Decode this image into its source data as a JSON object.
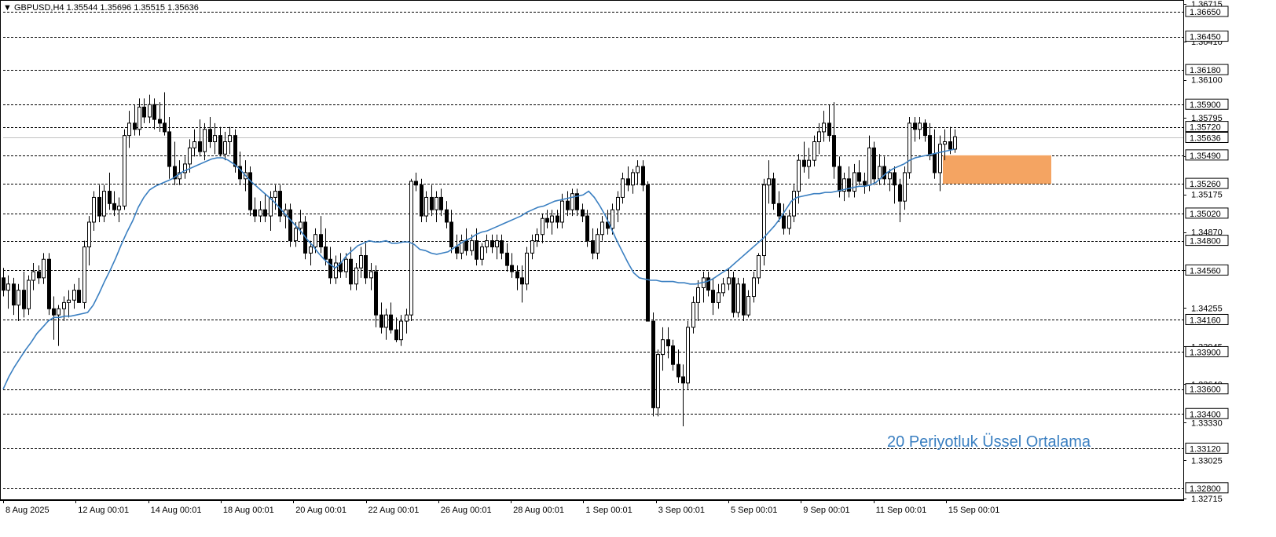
{
  "header": {
    "symbol_label": "GBPUSD,H4",
    "ohlc_label": "1.35544 1.35696 1.35515 1.35636"
  },
  "annotation": {
    "ema_label": "20 Periyotluk Üssel Ortalama"
  },
  "colors": {
    "background": "#ffffff",
    "candle": "#000000",
    "ema": "#3a7fc1",
    "zone": "#f4a462",
    "level_line": "#000000"
  },
  "chart_data": {
    "type": "candlestick",
    "symbol": "GBPUSD",
    "timeframe": "H4",
    "ylim": [
      1.3271,
      1.3672
    ],
    "y_axis_labels": [
      "1.36715",
      "1.36410",
      "1.36100",
      "1.35795",
      "1.35485",
      "1.35175",
      "1.34870",
      "1.34560",
      "1.34255",
      "1.33945",
      "1.33640",
      "1.33330",
      "1.33025",
      "1.32715"
    ],
    "price_levels": [
      "1.36650",
      "1.36450",
      "1.36180",
      "1.35900",
      "1.35720",
      "1.35490",
      "1.35260",
      "1.35020",
      "1.34800",
      "1.34560",
      "1.34160",
      "1.33900",
      "1.33600",
      "1.33400",
      "1.33120",
      "1.32800"
    ],
    "current_price": "1.35636",
    "x_labels": [
      "8 Aug 2025",
      "12 Aug 00:01",
      "14 Aug 00:01",
      "18 Aug 00:01",
      "20 Aug 00:01",
      "22 Aug 00:01",
      "26 Aug 00:01",
      "28 Aug 00:01",
      "1 Sep 00:01",
      "3 Sep 00:01",
      "5 Sep 00:01",
      "9 Sep 00:01",
      "11 Sep 00:01",
      "15 Sep 00:01"
    ],
    "candles": [
      [
        1.345,
        1.3458,
        1.3435,
        1.344
      ],
      [
        1.344,
        1.3452,
        1.3425,
        1.3445
      ],
      [
        1.3445,
        1.345,
        1.342,
        1.3428
      ],
      [
        1.3428,
        1.3445,
        1.3415,
        1.344
      ],
      [
        1.344,
        1.3455,
        1.3418,
        1.3425
      ],
      [
        1.3425,
        1.3452,
        1.342,
        1.3448
      ],
      [
        1.3448,
        1.3462,
        1.344,
        1.3455
      ],
      [
        1.3455,
        1.346,
        1.3445,
        1.345
      ],
      [
        1.345,
        1.347,
        1.3445,
        1.3465
      ],
      [
        1.3465,
        1.347,
        1.342,
        1.3425
      ],
      [
        1.3425,
        1.3435,
        1.34,
        1.342
      ],
      [
        1.342,
        1.3428,
        1.3395,
        1.3425
      ],
      [
        1.3425,
        1.3435,
        1.3415,
        1.343
      ],
      [
        1.343,
        1.344,
        1.3418,
        1.3432
      ],
      [
        1.3432,
        1.3445,
        1.3425,
        1.344
      ],
      [
        1.344,
        1.345,
        1.343,
        1.343
      ],
      [
        1.343,
        1.348,
        1.3425,
        1.3475
      ],
      [
        1.3475,
        1.35,
        1.346,
        1.3495
      ],
      [
        1.3495,
        1.352,
        1.3488,
        1.3515
      ],
      [
        1.3515,
        1.3525,
        1.3495,
        1.35
      ],
      [
        1.35,
        1.3525,
        1.3495,
        1.352
      ],
      [
        1.352,
        1.3535,
        1.3505,
        1.351
      ],
      [
        1.351,
        1.352,
        1.35,
        1.3505
      ],
      [
        1.3505,
        1.3515,
        1.3495,
        1.3508
      ],
      [
        1.3508,
        1.357,
        1.3505,
        1.3565
      ],
      [
        1.3565,
        1.3585,
        1.3555,
        1.3575
      ],
      [
        1.3575,
        1.359,
        1.3565,
        1.357
      ],
      [
        1.357,
        1.3595,
        1.3565,
        1.3588
      ],
      [
        1.3588,
        1.3595,
        1.3575,
        1.358
      ],
      [
        1.358,
        1.3598,
        1.3575,
        1.359
      ],
      [
        1.359,
        1.3595,
        1.357,
        1.3578
      ],
      [
        1.3578,
        1.3592,
        1.3568,
        1.3575
      ],
      [
        1.3575,
        1.36,
        1.3565,
        1.3568
      ],
      [
        1.3568,
        1.358,
        1.353,
        1.354
      ],
      [
        1.354,
        1.356,
        1.3525,
        1.353
      ],
      [
        1.353,
        1.3545,
        1.3525,
        1.3535
      ],
      [
        1.3535,
        1.3548,
        1.353,
        1.3542
      ],
      [
        1.3542,
        1.3562,
        1.3535,
        1.3555
      ],
      [
        1.3555,
        1.357,
        1.3548,
        1.356
      ],
      [
        1.356,
        1.3578,
        1.3548,
        1.3552
      ],
      [
        1.3552,
        1.3575,
        1.3545,
        1.357
      ],
      [
        1.357,
        1.358,
        1.3555,
        1.356
      ],
      [
        1.356,
        1.3575,
        1.355,
        1.3565
      ],
      [
        1.3565,
        1.3572,
        1.3548,
        1.355
      ],
      [
        1.355,
        1.3568,
        1.3545,
        1.356
      ],
      [
        1.356,
        1.3572,
        1.355,
        1.3565
      ],
      [
        1.3565,
        1.357,
        1.3535,
        1.354
      ],
      [
        1.354,
        1.3552,
        1.3525,
        1.353
      ],
      [
        1.353,
        1.3545,
        1.352,
        1.3535
      ],
      [
        1.3535,
        1.354,
        1.35,
        1.3505
      ],
      [
        1.3505,
        1.3515,
        1.3495,
        1.35
      ],
      [
        1.35,
        1.3512,
        1.3495,
        1.3505
      ],
      [
        1.3505,
        1.3518,
        1.3495,
        1.35
      ],
      [
        1.35,
        1.352,
        1.3488,
        1.3515
      ],
      [
        1.3515,
        1.3525,
        1.3505,
        1.352
      ],
      [
        1.352,
        1.3525,
        1.3495,
        1.35
      ],
      [
        1.35,
        1.351,
        1.349,
        1.3505
      ],
      [
        1.3505,
        1.351,
        1.3475,
        1.348
      ],
      [
        1.348,
        1.3495,
        1.3475,
        1.349
      ],
      [
        1.349,
        1.3505,
        1.3485,
        1.3495
      ],
      [
        1.3495,
        1.35,
        1.3465,
        1.347
      ],
      [
        1.347,
        1.348,
        1.346,
        1.3475
      ],
      [
        1.3475,
        1.349,
        1.347,
        1.3485
      ],
      [
        1.3485,
        1.35,
        1.347,
        1.3475
      ],
      [
        1.3475,
        1.349,
        1.346,
        1.3465
      ],
      [
        1.3465,
        1.3475,
        1.3445,
        1.345
      ],
      [
        1.345,
        1.3468,
        1.3445,
        1.3462
      ],
      [
        1.3462,
        1.347,
        1.345,
        1.3455
      ],
      [
        1.3455,
        1.347,
        1.345,
        1.3465
      ],
      [
        1.3465,
        1.3475,
        1.344,
        1.3445
      ],
      [
        1.3445,
        1.3462,
        1.344,
        1.3458
      ],
      [
        1.3458,
        1.3475,
        1.345,
        1.3468
      ],
      [
        1.3468,
        1.3478,
        1.3445,
        1.345
      ],
      [
        1.345,
        1.3462,
        1.344,
        1.3455
      ],
      [
        1.3455,
        1.346,
        1.341,
        1.342
      ],
      [
        1.342,
        1.343,
        1.3405,
        1.341
      ],
      [
        1.341,
        1.3425,
        1.34,
        1.342
      ],
      [
        1.342,
        1.343,
        1.3405,
        1.3408
      ],
      [
        1.3408,
        1.3418,
        1.3398,
        1.34
      ],
      [
        1.34,
        1.342,
        1.3395,
        1.3415
      ],
      [
        1.3415,
        1.3425,
        1.3405,
        1.342
      ],
      [
        1.342,
        1.353,
        1.3415,
        1.3528
      ],
      [
        1.3528,
        1.3535,
        1.352,
        1.3525
      ],
      [
        1.3525,
        1.353,
        1.3495,
        1.35
      ],
      [
        1.35,
        1.352,
        1.3495,
        1.3515
      ],
      [
        1.3515,
        1.3525,
        1.35,
        1.3505
      ],
      [
        1.3505,
        1.352,
        1.3495,
        1.3515
      ],
      [
        1.3515,
        1.3522,
        1.35,
        1.3505
      ],
      [
        1.3505,
        1.3512,
        1.349,
        1.3495
      ],
      [
        1.3495,
        1.3505,
        1.347,
        1.3475
      ],
      [
        1.3475,
        1.3485,
        1.3465,
        1.347
      ],
      [
        1.347,
        1.3485,
        1.3465,
        1.348
      ],
      [
        1.348,
        1.349,
        1.3468,
        1.3472
      ],
      [
        1.3472,
        1.3485,
        1.3468,
        1.348
      ],
      [
        1.348,
        1.349,
        1.346,
        1.3465
      ],
      [
        1.3465,
        1.3478,
        1.346,
        1.3475
      ],
      [
        1.3475,
        1.3485,
        1.347,
        1.348
      ],
      [
        1.348,
        1.3485,
        1.347,
        1.3475
      ],
      [
        1.3475,
        1.3485,
        1.3465,
        1.348
      ],
      [
        1.348,
        1.3485,
        1.3465,
        1.347
      ],
      [
        1.347,
        1.3478,
        1.3455,
        1.346
      ],
      [
        1.346,
        1.347,
        1.345,
        1.3455
      ],
      [
        1.3455,
        1.346,
        1.344,
        1.345
      ],
      [
        1.345,
        1.346,
        1.343,
        1.3445
      ],
      [
        1.3445,
        1.3475,
        1.344,
        1.347
      ],
      [
        1.347,
        1.3485,
        1.3465,
        1.348
      ],
      [
        1.348,
        1.349,
        1.3475,
        1.3485
      ],
      [
        1.3485,
        1.3502,
        1.3478,
        1.3498
      ],
      [
        1.3498,
        1.3505,
        1.349,
        1.3495
      ],
      [
        1.3495,
        1.3505,
        1.3485,
        1.35
      ],
      [
        1.35,
        1.3505,
        1.349,
        1.3495
      ],
      [
        1.3495,
        1.3518,
        1.349,
        1.3512
      ],
      [
        1.3512,
        1.352,
        1.35,
        1.3505
      ],
      [
        1.3505,
        1.3522,
        1.35,
        1.3518
      ],
      [
        1.3518,
        1.3522,
        1.35,
        1.3505
      ],
      [
        1.3505,
        1.351,
        1.3495,
        1.35
      ],
      [
        1.35,
        1.3505,
        1.3475,
        1.348
      ],
      [
        1.348,
        1.349,
        1.3465,
        1.347
      ],
      [
        1.347,
        1.349,
        1.3465,
        1.3485
      ],
      [
        1.3485,
        1.35,
        1.348,
        1.3495
      ],
      [
        1.3495,
        1.3505,
        1.3485,
        1.349
      ],
      [
        1.349,
        1.351,
        1.3485,
        1.3505
      ],
      [
        1.3505,
        1.352,
        1.3495,
        1.3515
      ],
      [
        1.3515,
        1.3535,
        1.351,
        1.353
      ],
      [
        1.353,
        1.354,
        1.352,
        1.3525
      ],
      [
        1.3525,
        1.3538,
        1.3518,
        1.3535
      ],
      [
        1.3535,
        1.3545,
        1.3525,
        1.354
      ],
      [
        1.354,
        1.3545,
        1.352,
        1.3525
      ],
      [
        1.3525,
        1.3528,
        1.342,
        1.3415
      ],
      [
        1.3415,
        1.3422,
        1.3338,
        1.3345
      ],
      [
        1.3345,
        1.3392,
        1.3338,
        1.3388
      ],
      [
        1.3388,
        1.341,
        1.3375,
        1.34
      ],
      [
        1.34,
        1.341,
        1.3385,
        1.3395
      ],
      [
        1.3395,
        1.34,
        1.3375,
        1.338
      ],
      [
        1.338,
        1.3392,
        1.3365,
        1.337
      ],
      [
        1.337,
        1.338,
        1.333,
        1.3365
      ],
      [
        1.3365,
        1.3415,
        1.336,
        1.341
      ],
      [
        1.341,
        1.3435,
        1.3405,
        1.343
      ],
      [
        1.343,
        1.3448,
        1.3415,
        1.3442
      ],
      [
        1.3442,
        1.3455,
        1.343,
        1.345
      ],
      [
        1.345,
        1.3455,
        1.3435,
        1.344
      ],
      [
        1.344,
        1.345,
        1.342,
        1.343
      ],
      [
        1.343,
        1.3445,
        1.3425,
        1.3438
      ],
      [
        1.3438,
        1.345,
        1.3435,
        1.3445
      ],
      [
        1.3445,
        1.3458,
        1.344,
        1.345
      ],
      [
        1.345,
        1.3455,
        1.3418,
        1.3422
      ],
      [
        1.3422,
        1.345,
        1.3418,
        1.3445
      ],
      [
        1.3445,
        1.345,
        1.3415,
        1.342
      ],
      [
        1.342,
        1.344,
        1.3418,
        1.3435
      ],
      [
        1.3435,
        1.3455,
        1.343,
        1.345
      ],
      [
        1.345,
        1.347,
        1.3445,
        1.3468
      ],
      [
        1.3468,
        1.353,
        1.346,
        1.3525
      ],
      [
        1.3525,
        1.3545,
        1.351,
        1.353
      ],
      [
        1.353,
        1.3535,
        1.3505,
        1.351
      ],
      [
        1.351,
        1.352,
        1.3495,
        1.35
      ],
      [
        1.35,
        1.351,
        1.3485,
        1.349
      ],
      [
        1.349,
        1.3505,
        1.3485,
        1.35
      ],
      [
        1.35,
        1.3525,
        1.3495,
        1.352
      ],
      [
        1.352,
        1.355,
        1.351,
        1.3545
      ],
      [
        1.3545,
        1.356,
        1.3535,
        1.354
      ],
      [
        1.354,
        1.3555,
        1.353,
        1.3545
      ],
      [
        1.3545,
        1.3565,
        1.354,
        1.356
      ],
      [
        1.356,
        1.3575,
        1.355,
        1.3568
      ],
      [
        1.3568,
        1.3585,
        1.356,
        1.3575
      ],
      [
        1.3575,
        1.359,
        1.356,
        1.3565
      ],
      [
        1.3565,
        1.3592,
        1.353,
        1.354
      ],
      [
        1.354,
        1.3548,
        1.3515,
        1.352
      ],
      [
        1.352,
        1.3535,
        1.3512,
        1.353
      ],
      [
        1.353,
        1.354,
        1.3515,
        1.352
      ],
      [
        1.352,
        1.3542,
        1.3515,
        1.3535
      ],
      [
        1.3535,
        1.3545,
        1.3525,
        1.3528
      ],
      [
        1.3528,
        1.3535,
        1.3518,
        1.3525
      ],
      [
        1.3525,
        1.3565,
        1.352,
        1.3555
      ],
      [
        1.3555,
        1.356,
        1.3525,
        1.353
      ],
      [
        1.353,
        1.355,
        1.3525,
        1.354
      ],
      [
        1.354,
        1.3548,
        1.3525,
        1.353
      ],
      [
        1.353,
        1.3538,
        1.352,
        1.3535
      ],
      [
        1.3535,
        1.354,
        1.351,
        1.3525
      ],
      [
        1.3525,
        1.353,
        1.3495,
        1.3512
      ],
      [
        1.3512,
        1.354,
        1.3505,
        1.3535
      ],
      [
        1.3535,
        1.358,
        1.353,
        1.3575
      ],
      [
        1.3575,
        1.358,
        1.356,
        1.357
      ],
      [
        1.357,
        1.358,
        1.3562,
        1.3575
      ],
      [
        1.3575,
        1.3578,
        1.356,
        1.3565
      ],
      [
        1.3565,
        1.3575,
        1.3545,
        1.355
      ],
      [
        1.355,
        1.357,
        1.353,
        1.3535
      ],
      [
        1.3535,
        1.3565,
        1.352,
        1.3558
      ],
      [
        1.3558,
        1.357,
        1.3545,
        1.356
      ],
      [
        1.356,
        1.3572,
        1.355,
        1.3554
      ],
      [
        1.3554,
        1.357,
        1.3551,
        1.3564
      ]
    ],
    "ema": {
      "name": "20 Periyotluk Üssel Ortalama",
      "period": 20,
      "values": [
        1.336,
        1.337,
        1.3378,
        1.3385,
        1.3392,
        1.3398,
        1.3405,
        1.341,
        1.3415,
        1.3418,
        1.3418,
        1.3419,
        1.3419,
        1.342,
        1.3421,
        1.3422,
        1.3428,
        1.3437,
        1.3447,
        1.3456,
        1.3466,
        1.3477,
        1.3487,
        1.3496,
        1.3507,
        1.3515,
        1.3521,
        1.3524,
        1.3526,
        1.3528,
        1.353,
        1.3533,
        1.3536,
        1.3538,
        1.354,
        1.3542,
        1.3544,
        1.3546,
        1.3547,
        1.3547,
        1.3545,
        1.3542,
        1.3538,
        1.3533,
        1.3528,
        1.3524,
        1.352,
        1.3516,
        1.3512,
        1.3507,
        1.3502,
        1.3497,
        1.3492,
        1.3487,
        1.3481,
        1.3476,
        1.347,
        1.3465,
        1.3461,
        1.3458,
        1.3462,
        1.3468,
        1.3472,
        1.3476,
        1.3478,
        1.348,
        1.3479,
        1.3479,
        1.348,
        1.3478,
        1.3478,
        1.3479,
        1.3479,
        1.3477,
        1.3473,
        1.3472,
        1.347,
        1.3469,
        1.347,
        1.3471,
        1.3474,
        1.3477,
        1.348,
        1.3482,
        1.3485,
        1.3487,
        1.3488,
        1.349,
        1.3492,
        1.3494,
        1.3496,
        1.3498,
        1.35,
        1.3503,
        1.3505,
        1.3507,
        1.3508,
        1.351,
        1.3512,
        1.3513,
        1.3514,
        1.3515,
        1.3516,
        1.3517,
        1.352,
        1.3515,
        1.3508,
        1.35,
        1.349,
        1.348,
        1.3471,
        1.3462,
        1.3454,
        1.345,
        1.3449,
        1.3448,
        1.3448,
        1.3447,
        1.3447,
        1.3447,
        1.3446,
        1.3446,
        1.3445,
        1.3445,
        1.3446,
        1.3447,
        1.3449,
        1.3452,
        1.3455,
        1.3458,
        1.3462,
        1.3466,
        1.347,
        1.3474,
        1.3478,
        1.3482,
        1.3487,
        1.3492,
        1.3498,
        1.3505,
        1.3512,
        1.3515,
        1.3516,
        1.3517,
        1.3518,
        1.3518,
        1.3519,
        1.3519,
        1.352,
        1.3521,
        1.3522,
        1.3523,
        1.3524,
        1.3524,
        1.3525,
        1.3527,
        1.3531,
        1.3535,
        1.3538,
        1.354,
        1.3542,
        1.3545,
        1.3547,
        1.3548,
        1.3549,
        1.355,
        1.3551,
        1.3552,
        1.3553,
        1.3554
      ]
    },
    "zone": {
      "price_top": 1.3549,
      "price_bottom": 1.3526
    }
  }
}
